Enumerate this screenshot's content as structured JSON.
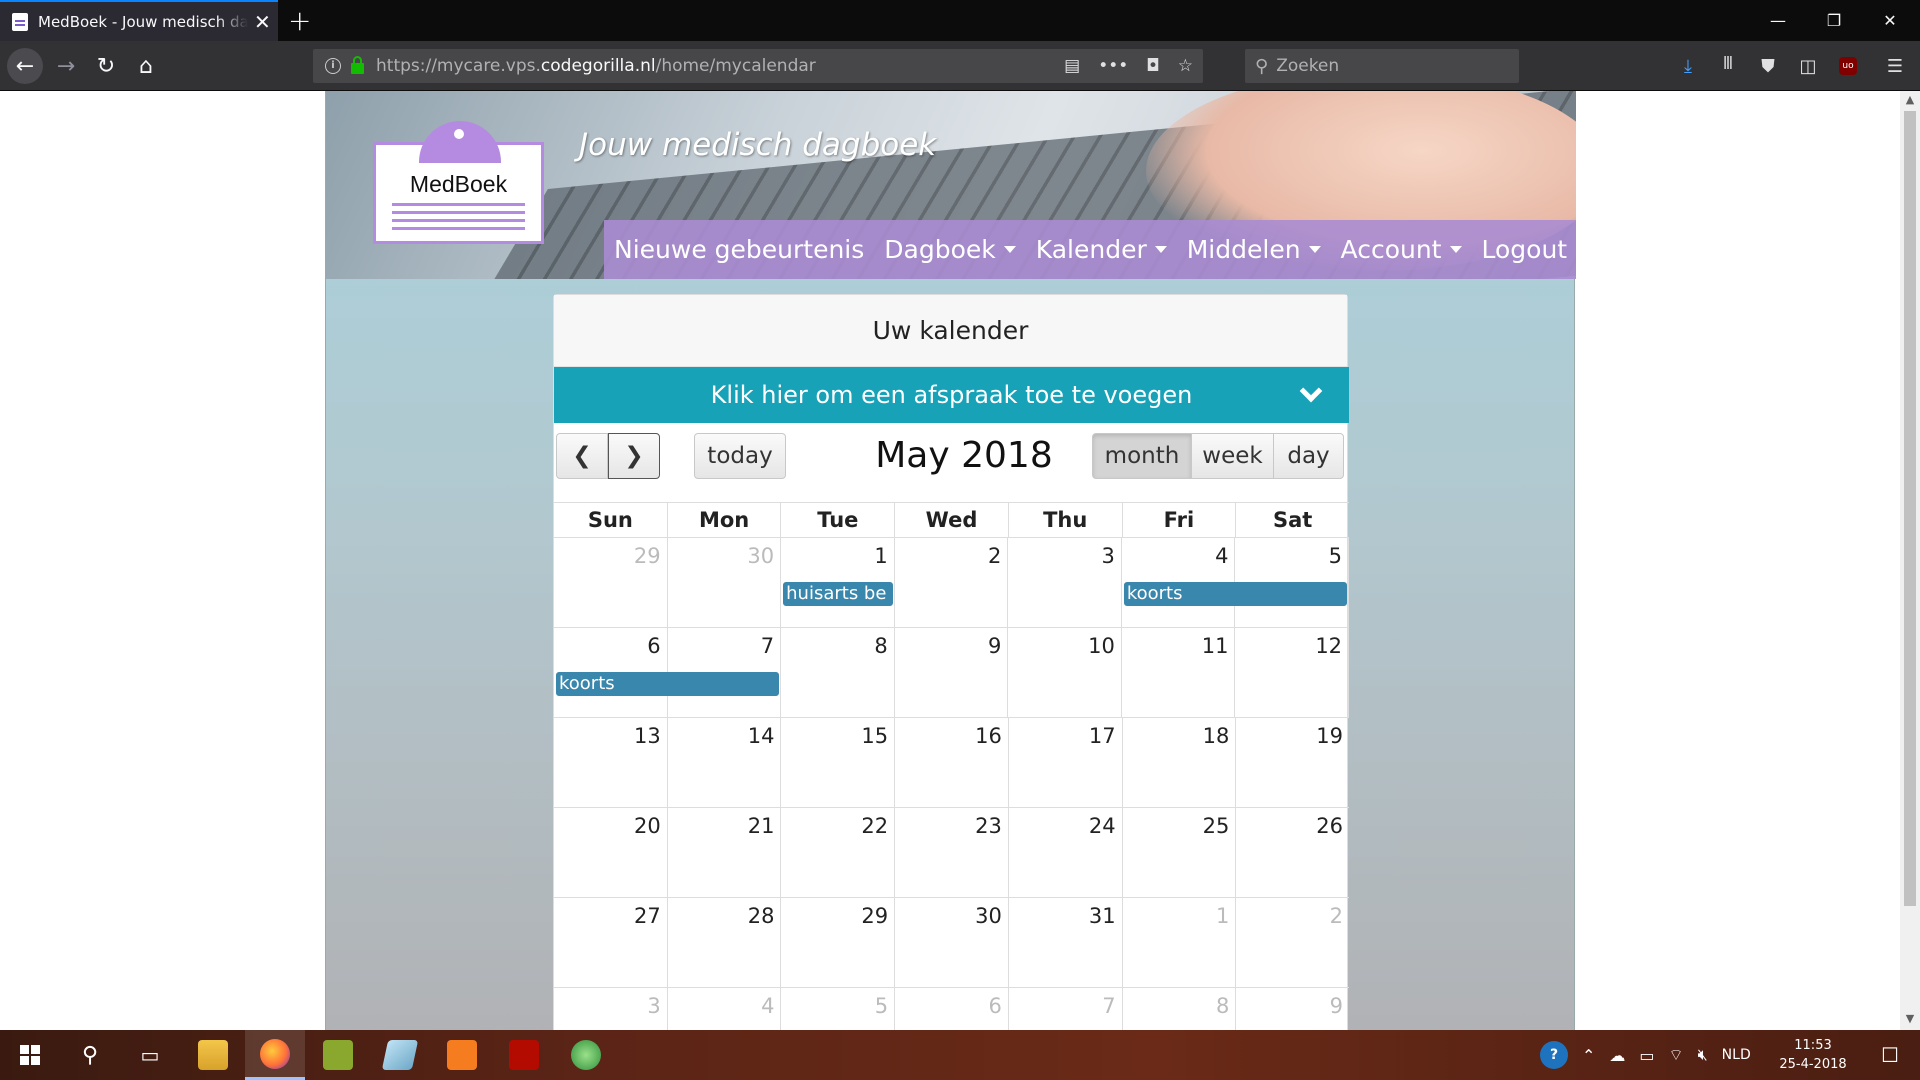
{
  "browser": {
    "tab_title": "MedBoek - Jouw medisch dagboek",
    "url_prefix": "https://mycare.vps.",
    "url_host": "codegorilla.nl",
    "url_path": "/home/mycalendar",
    "search_placeholder": "Zoeken"
  },
  "site": {
    "logo_text": "MedBoek",
    "slogan": "Jouw medisch dagboek",
    "nav": [
      {
        "label": "Nieuwe gebeurtenis"
      },
      {
        "label": "Dagboek"
      },
      {
        "label": "Kalender"
      },
      {
        "label": "Middelen"
      },
      {
        "label": "Account"
      },
      {
        "label": "Logout"
      }
    ]
  },
  "calendar": {
    "card_title": "Uw kalender",
    "add_appointment": "Klik hier om een afspraak toe te voegen",
    "today_label": "today",
    "title": "May 2018",
    "views": {
      "month": "month",
      "week": "week",
      "day": "day"
    },
    "active_view": "month",
    "dow": [
      "Sun",
      "Mon",
      "Tue",
      "Wed",
      "Thu",
      "Fri",
      "Sat"
    ],
    "weeks": [
      [
        {
          "d": "29",
          "o": true
        },
        {
          "d": "30",
          "o": true
        },
        {
          "d": "1"
        },
        {
          "d": "2"
        },
        {
          "d": "3"
        },
        {
          "d": "4"
        },
        {
          "d": "5"
        }
      ],
      [
        {
          "d": "6"
        },
        {
          "d": "7"
        },
        {
          "d": "8"
        },
        {
          "d": "9"
        },
        {
          "d": "10"
        },
        {
          "d": "11"
        },
        {
          "d": "12"
        }
      ],
      [
        {
          "d": "13"
        },
        {
          "d": "14"
        },
        {
          "d": "15"
        },
        {
          "d": "16"
        },
        {
          "d": "17"
        },
        {
          "d": "18"
        },
        {
          "d": "19"
        }
      ],
      [
        {
          "d": "20"
        },
        {
          "d": "21"
        },
        {
          "d": "22"
        },
        {
          "d": "23"
        },
        {
          "d": "24"
        },
        {
          "d": "25"
        },
        {
          "d": "26"
        }
      ],
      [
        {
          "d": "27"
        },
        {
          "d": "28"
        },
        {
          "d": "29"
        },
        {
          "d": "30"
        },
        {
          "d": "31"
        },
        {
          "d": "1",
          "o": true
        },
        {
          "d": "2",
          "o": true
        }
      ],
      [
        {
          "d": "3",
          "o": true
        },
        {
          "d": "4",
          "o": true
        },
        {
          "d": "5",
          "o": true
        },
        {
          "d": "6",
          "o": true
        },
        {
          "d": "7",
          "o": true
        },
        {
          "d": "8",
          "o": true
        },
        {
          "d": "9",
          "o": true
        }
      ]
    ],
    "events": [
      {
        "title": "huisarts be",
        "week": 0,
        "start": 2,
        "span": 1
      },
      {
        "title": "koorts",
        "week": 0,
        "start": 5,
        "span": 2
      },
      {
        "title": "koorts",
        "week": 1,
        "start": 0,
        "span": 2
      }
    ]
  },
  "taskbar": {
    "language": "NLD",
    "time": "11:53",
    "date": "25-4-2018"
  },
  "colors": {
    "nav_purple": "#aa8cd2",
    "accent_teal": "#17a2b8",
    "event_blue": "#3a87ad",
    "logo_purple": "#b48be0"
  }
}
